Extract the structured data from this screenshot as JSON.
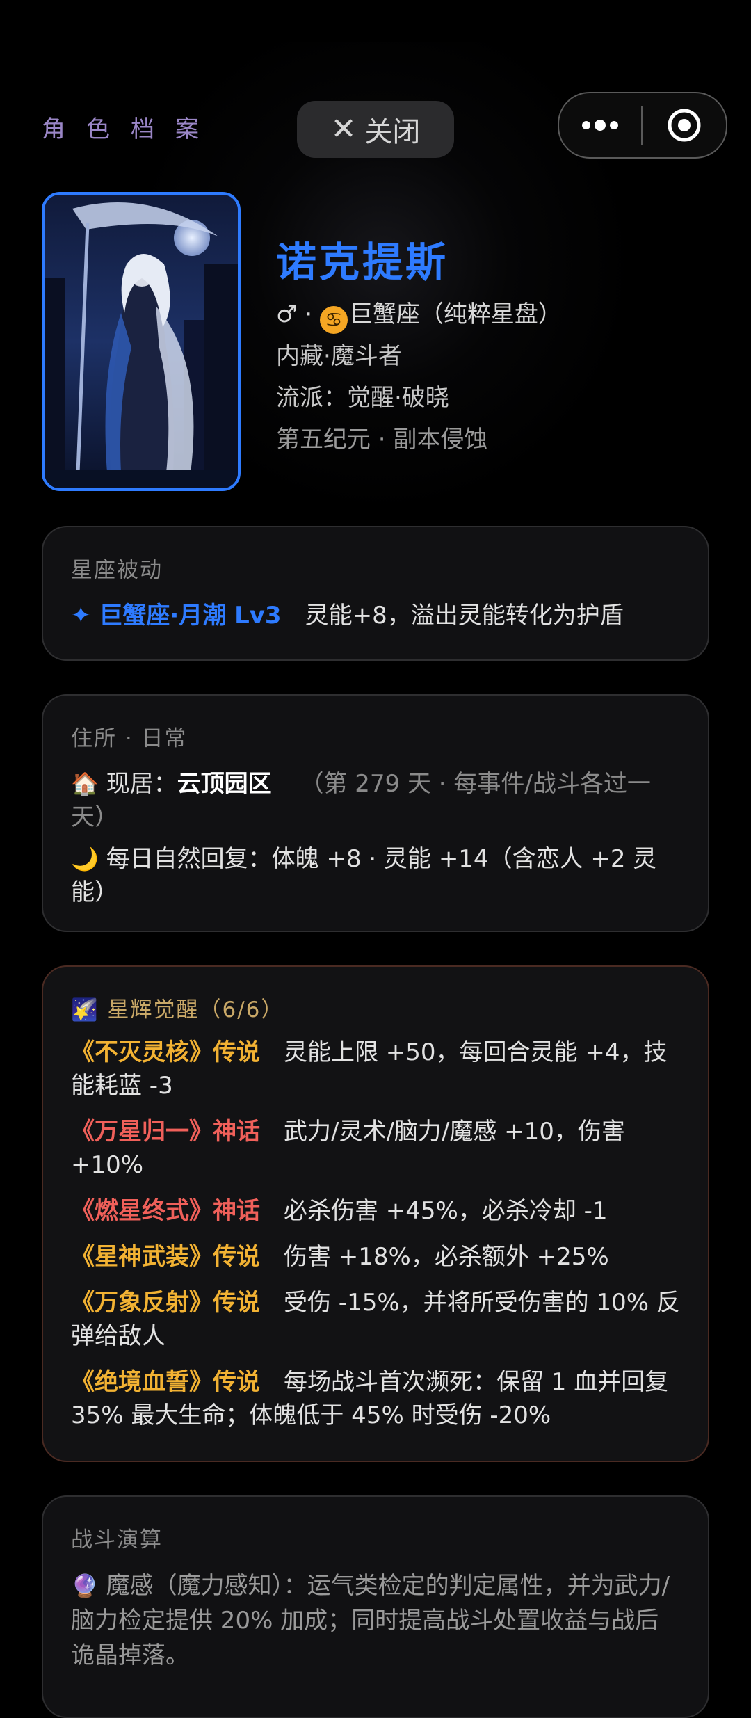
{
  "header": {
    "page_label": "角色档案",
    "close_label": "关闭"
  },
  "profile": {
    "name": "诺克提斯",
    "gender_symbol": "♂",
    "separator": "·",
    "zodiac_text": "巨蟹座（纯粹星盘）",
    "race": "内藏·魔斗者",
    "school": "流派：觉醒·破晓",
    "era": "第五纪元 · 副本侵蚀"
  },
  "zodiac_passive": {
    "title": "星座被动",
    "name": "✦ 巨蟹座·月潮 Lv3",
    "desc": "灵能+8，溢出灵能转化为护盾"
  },
  "home": {
    "title": "住所 · 日常",
    "residence_icon": "🏠",
    "residence_label": "现居：",
    "residence_name": "云顶园区",
    "day_note": "（第 279 天 · 每事件/战斗各过一天）",
    "regen_icon": "🌙",
    "regen_text": "每日自然回复：体魄 +8 · 灵能 +14（含恋人 +2 灵能）"
  },
  "awakening": {
    "title_icon": "🌠",
    "title": "星辉觉醒（6/6）",
    "items": [
      {
        "name": "《不灭灵核》传说",
        "tier": "gold",
        "desc": "灵能上限 +50，每回合灵能 +4，技能耗蓝 -3"
      },
      {
        "name": "《万星归一》神话",
        "tier": "red",
        "desc": "武力/灵术/脑力/魔感 +10，伤害 +10%"
      },
      {
        "name": "《燃星终式》神话",
        "tier": "red",
        "desc": "必杀伤害 +45%，必杀冷却 -1"
      },
      {
        "name": "《星神武装》传说",
        "tier": "gold",
        "desc": "伤害 +18%，必杀额外 +25%"
      },
      {
        "name": "《万象反射》传说",
        "tier": "gold",
        "desc": "受伤 -15%，并将所受伤害的 10% 反弹给敌人"
      },
      {
        "name": "《绝境血誓》传说",
        "tier": "gold",
        "desc": "每场战斗首次濒死：保留 1 血并回复 35% 最大生命；体魄低于 45% 时受伤 -20%"
      }
    ]
  },
  "battle": {
    "title": "战斗演算",
    "icon": "🔮",
    "text": "魔感（魔力感知）：运气类检定的判定属性，并为武力/脑力检定提供 20% 加成；同时提高战斗处置收益与战后诡晶掉落。"
  },
  "colors": {
    "accent_blue": "#2e7bff",
    "legend_gold": "#f2b233",
    "myth_red": "#f0605a",
    "label_purple": "#9a86c6"
  }
}
